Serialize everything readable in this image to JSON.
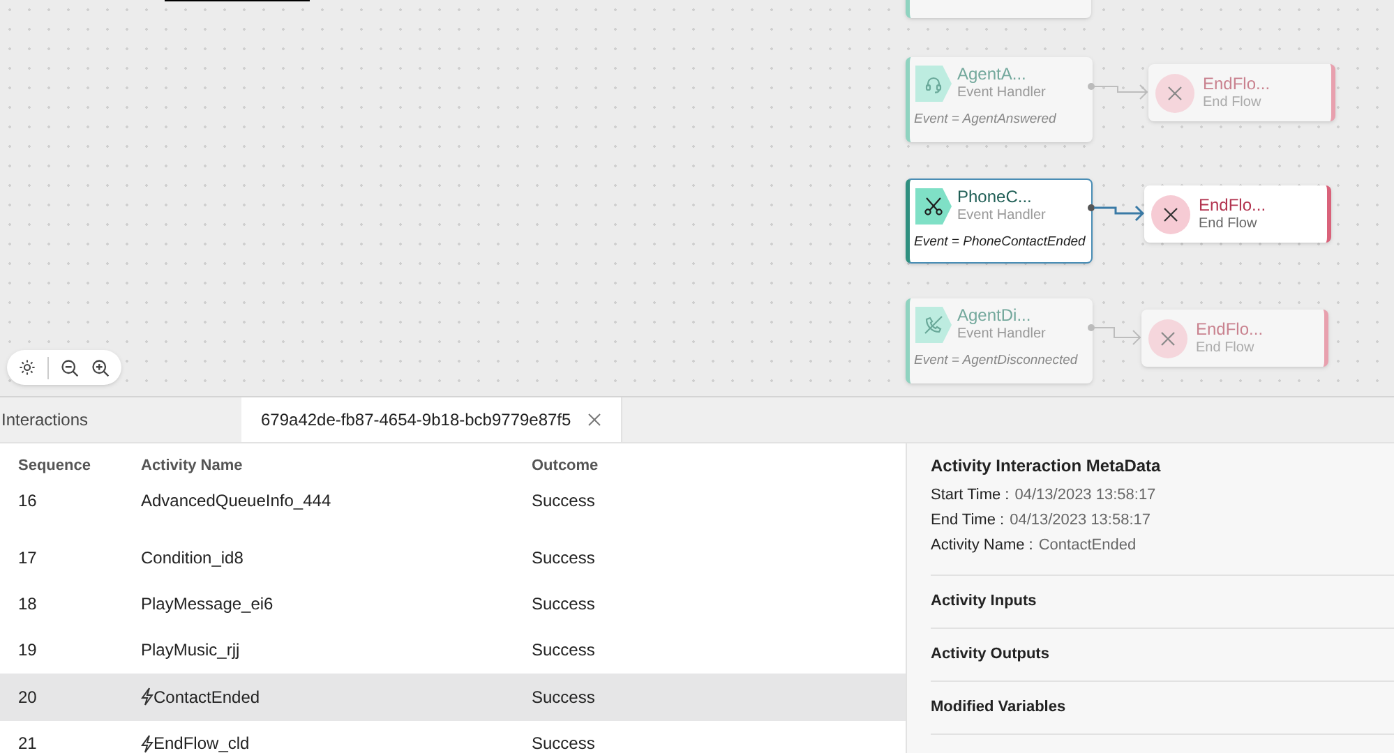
{
  "canvas": {
    "handlers": [
      {
        "title": "AgentA...",
        "subtitle": "Event Handler",
        "event": "Event = AgentAnswered",
        "selected": false,
        "end": {
          "title": "EndFlo...",
          "subtitle": "End Flow"
        }
      },
      {
        "title": "PhoneC...",
        "subtitle": "Event Handler",
        "event": "Event = PhoneContactEnded",
        "selected": true,
        "end": {
          "title": "EndFlo...",
          "subtitle": "End Flow"
        }
      },
      {
        "title": "AgentDi...",
        "subtitle": "Event Handler",
        "event": "Event = AgentDisconnected",
        "selected": false,
        "end": {
          "title": "EndFlo...",
          "subtitle": "End Flow"
        }
      }
    ]
  },
  "tabs": [
    {
      "label": "Interactions",
      "selected": false,
      "closable": false
    },
    {
      "label": "679a42de-fb87-4654-9b18-bcb9779e87f5",
      "selected": true,
      "closable": true
    }
  ],
  "table": {
    "columns": [
      "Sequence",
      "Activity Name",
      "Outcome"
    ],
    "rows": [
      {
        "sequence": "16",
        "activity": "AdvancedQueueInfo_444",
        "outcome": "Success",
        "kind": "activity",
        "selected": false
      },
      {
        "sequence": "17",
        "activity": "Condition_id8",
        "outcome": "Success",
        "kind": "activity",
        "selected": false
      },
      {
        "sequence": "18",
        "activity": "PlayMessage_ei6",
        "outcome": "Success",
        "kind": "activity",
        "selected": false
      },
      {
        "sequence": "19",
        "activity": "PlayMusic_rjj",
        "outcome": "Success",
        "kind": "activity",
        "selected": false
      },
      {
        "sequence": "20",
        "activity": "ContactEnded",
        "outcome": "Success",
        "kind": "event",
        "selected": true
      },
      {
        "sequence": "21",
        "activity": "EndFlow_cld",
        "outcome": "Success",
        "kind": "event",
        "selected": false
      }
    ]
  },
  "details": {
    "title": "Activity Interaction MetaData",
    "fields": [
      {
        "label": "Start Time :",
        "value": "04/13/2023 13:58:17"
      },
      {
        "label": "End Time :",
        "value": "04/13/2023 13:58:17"
      },
      {
        "label": "Activity Name :",
        "value": "ContactEnded"
      }
    ],
    "sections": [
      "Activity Inputs",
      "Activity Outputs",
      "Modified Variables"
    ]
  }
}
